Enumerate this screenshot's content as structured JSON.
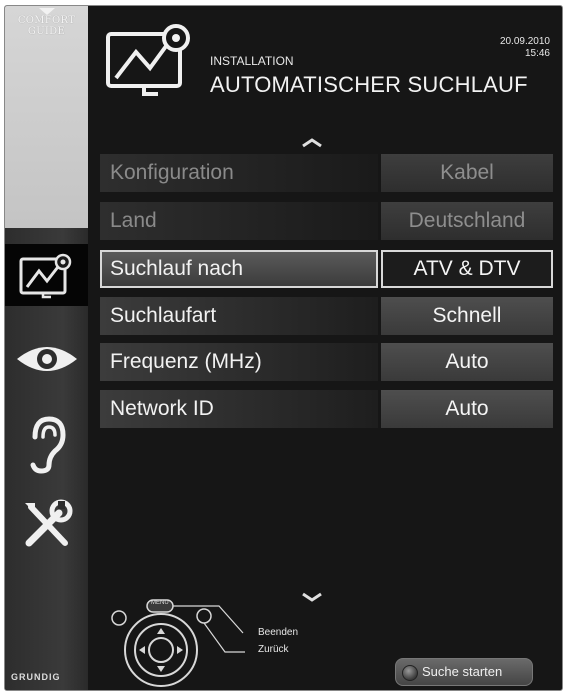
{
  "sidebar": {
    "comfort_guide": [
      "COMFORT",
      "GUIDE"
    ],
    "icons": [
      "installation-icon",
      "eye-icon",
      "ear-icon",
      "tools-icon"
    ],
    "brand": "GRUNDIG"
  },
  "header": {
    "subtitle": "INSTALLATION",
    "title": "AUTOMATISCHER SUCHLAUF",
    "date": "20.09.2010",
    "time": "15:46"
  },
  "rows": [
    {
      "label": "Konfiguration",
      "value": "Kabel",
      "state": "disabled"
    },
    {
      "label": "Land",
      "value": "Deutschland",
      "state": "disabled"
    },
    {
      "label": "Suchlauf nach",
      "value": "ATV & DTV",
      "state": "selected"
    },
    {
      "label": "Suchlaufart",
      "value": "Schnell",
      "state": "normal"
    },
    {
      "label": "Frequenz (MHz)",
      "value": "Auto",
      "state": "normal"
    },
    {
      "label": "Network ID",
      "value": "Auto",
      "state": "normal"
    }
  ],
  "footer": {
    "menu_key_label": "MENU",
    "hint_exit": "Beenden",
    "hint_back": "Zurück",
    "start_button": "Suche starten"
  }
}
